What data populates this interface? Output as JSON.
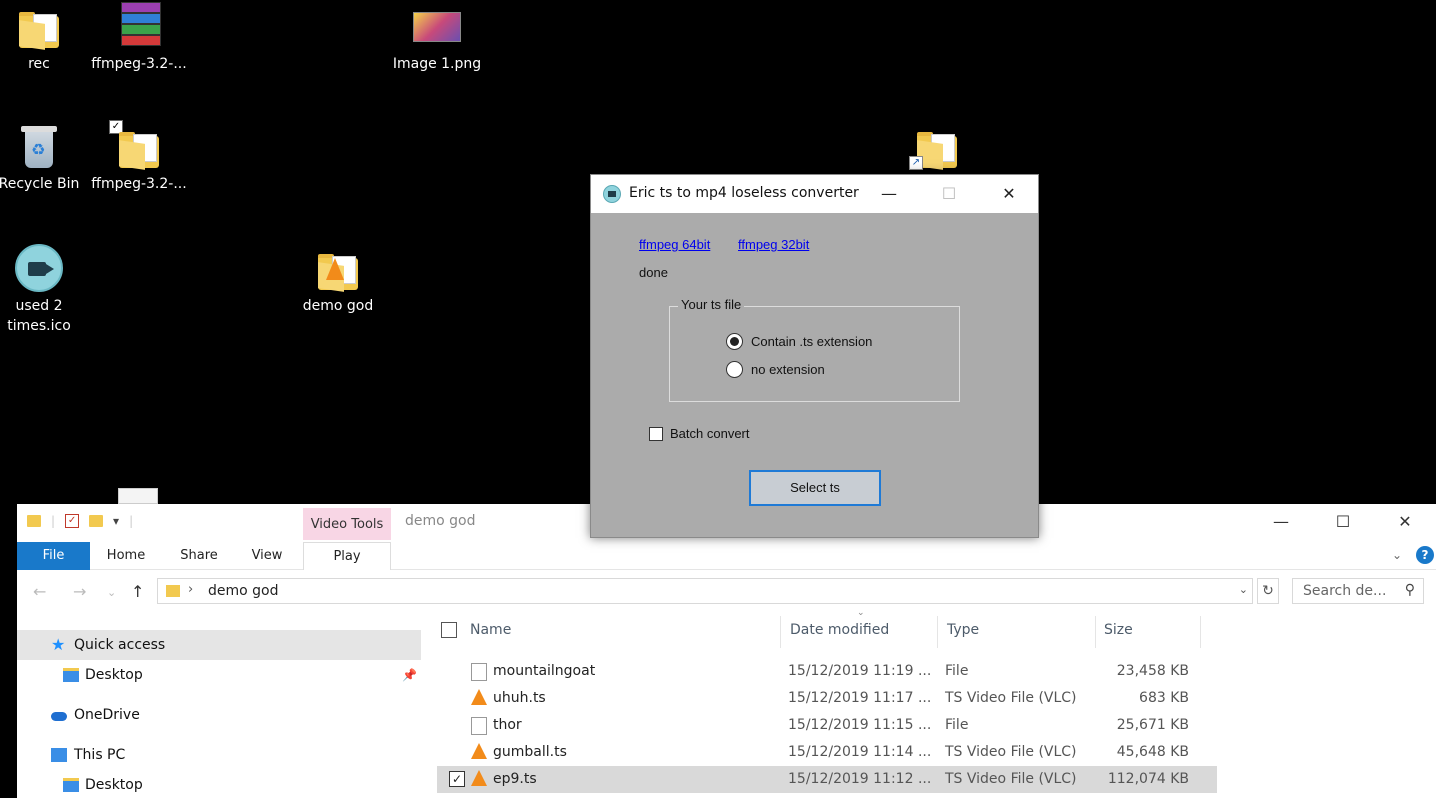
{
  "desktop": {
    "icons": [
      {
        "label": "rec",
        "icon": "folder-icon"
      },
      {
        "label": "ffmpeg-3.2-...",
        "icon": "winrar-archive-icon"
      },
      {
        "label": "Image 1.png",
        "icon": "image-icon"
      },
      {
        "label": "Recycle Bin",
        "icon": "recycle-bin-icon"
      },
      {
        "label": "ffmpeg-3.2-...",
        "icon": "folder-icon"
      },
      {
        "label": "used 2 times.ico",
        "icon": "camera-icon"
      },
      {
        "label": "demo god",
        "icon": "vlc-folder-icon"
      }
    ]
  },
  "dialog": {
    "title": "Eric ts to mp4 loseless converter",
    "minimize": "—",
    "maximize": "☐",
    "close": "✕",
    "link_64": "ffmpeg 64bit",
    "link_32": "ffmpeg 32bit",
    "status": "done",
    "group_label": "Your ts file",
    "radio_1": "Contain .ts extension",
    "radio_2": "no extension",
    "radio_selected": "Contain .ts extension",
    "batch_label": "Batch convert",
    "batch_checked": false,
    "select_button": "Select ts"
  },
  "explorer": {
    "title": "demo god",
    "context_tab": "Video Tools",
    "minimize": "—",
    "maximize": "☐",
    "close": "✕",
    "ribbon_tabs": {
      "file": "File",
      "home": "Home",
      "share": "Share",
      "view": "View",
      "play": "Play"
    },
    "help": "?",
    "address": {
      "path": "demo god",
      "separator": "›"
    },
    "search_placeholder": "Search de...",
    "nav": {
      "quick_access": "Quick access",
      "desktop": "Desktop",
      "onedrive": "OneDrive",
      "this_pc": "This PC",
      "desktop2": "Desktop"
    },
    "columns": {
      "name": "Name",
      "date": "Date modified",
      "type": "Type",
      "size": "Size"
    },
    "files": [
      {
        "name": "mountailngoat",
        "date": "15/12/2019 11:19 ...",
        "type": "File",
        "size": "23,458 KB",
        "icon": "file-icon"
      },
      {
        "name": "uhuh.ts",
        "date": "15/12/2019 11:17 ...",
        "type": "TS Video File (VLC)",
        "size": "683 KB",
        "icon": "vlc-icon"
      },
      {
        "name": "thor",
        "date": "15/12/2019 11:15 ...",
        "type": "File",
        "size": "25,671 KB",
        "icon": "file-icon"
      },
      {
        "name": "gumball.ts",
        "date": "15/12/2019 11:14 ...",
        "type": "TS Video File (VLC)",
        "size": "45,648 KB",
        "icon": "vlc-icon"
      },
      {
        "name": "ep9.ts",
        "date": "15/12/2019 11:12 ...",
        "type": "TS Video File (VLC)",
        "size": "112,074 KB",
        "icon": "vlc-icon",
        "selected": true
      }
    ]
  }
}
